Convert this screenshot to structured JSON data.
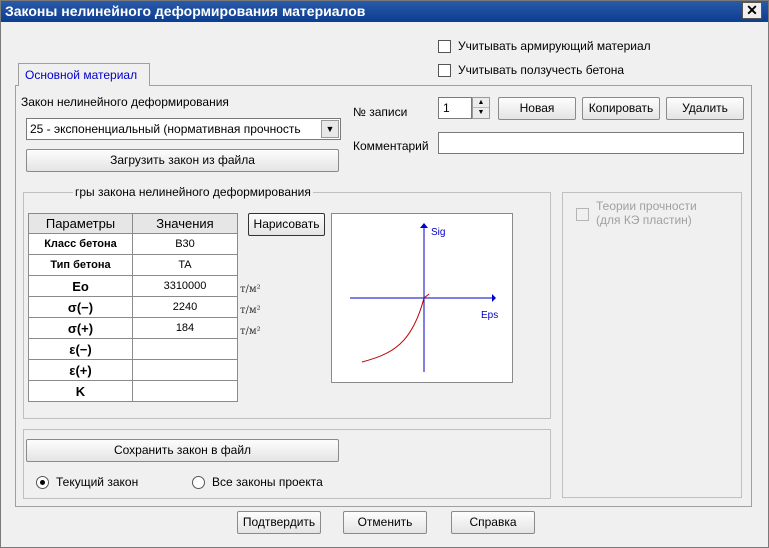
{
  "window": {
    "title": "Законы нелинейного деформирования материалов",
    "close": "✕"
  },
  "top_checks": {
    "reinforcing": "Учитывать армирующий материал",
    "creep": "Учитывать ползучесть бетона"
  },
  "tab": {
    "main": "Основной материал"
  },
  "law": {
    "label": "Закон нелинейного деформирования",
    "selected": "25 - экспоненциальный (нормативная прочность",
    "load_button": "Загрузить закон из файла"
  },
  "record": {
    "label": "№ записи",
    "value": "1",
    "new": "Новая",
    "copy": "Копировать",
    "delete": "Удалить",
    "comment_label": "Комментарий",
    "comment_value": ""
  },
  "params_group": {
    "title": "гры закона нелинейного деформирования",
    "draw_button": "Нарисовать",
    "columns": [
      "Параметры",
      "Значения"
    ],
    "rows": [
      {
        "param": "Класс бетона",
        "value": "B30",
        "unit": ""
      },
      {
        "param": "Тип бетона",
        "value": "TA",
        "unit": ""
      },
      {
        "param": "Eo",
        "value": "3310000",
        "unit": "т/м²"
      },
      {
        "param": "σ(−)",
        "value": "2240",
        "unit": "т/м²"
      },
      {
        "param": "σ(+)",
        "value": "184",
        "unit": "т/м²"
      },
      {
        "param": "ε(−)",
        "value": "",
        "unit": ""
      },
      {
        "param": "ε(+)",
        "value": "",
        "unit": ""
      },
      {
        "param": "K",
        "value": "",
        "unit": ""
      }
    ],
    "plot": {
      "y_label": "Sig",
      "x_label": "Eps",
      "curve_color": "#c00000",
      "axis_color": "#0000c8"
    }
  },
  "strength": {
    "label_line1": "Теории прочности",
    "label_line2": "(для КЭ пластин)"
  },
  "save_group": {
    "save_button": "Сохранить закон в файл",
    "radio_current": "Текущий закон",
    "radio_all": "Все законы проекта"
  },
  "footer": {
    "confirm": "Подтвердить",
    "cancel": "Отменить",
    "help": "Справка"
  }
}
